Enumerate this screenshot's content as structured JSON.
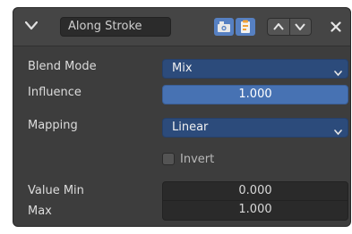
{
  "header": {
    "modifier_name": "Along Stroke",
    "collapse_icon": "chevron-down-icon",
    "render_icon": "camera-icon",
    "edit_icon": "clipboard-icon",
    "move_up_icon": "triangle-up-icon",
    "move_down_icon": "triangle-down-icon",
    "close_icon": "close-icon",
    "accent": "#5680c2"
  },
  "props": {
    "blend_mode_label": "Blend Mode",
    "blend_mode_value": "Mix",
    "influence_label": "Influence",
    "influence_value": "1.000",
    "mapping_label": "Mapping",
    "mapping_value": "Linear",
    "invert_label": "Invert",
    "invert_checked": false,
    "value_min_label": "Value Min",
    "value_min": "0.000",
    "max_label": "Max",
    "max_value": "1.000"
  },
  "colors": {
    "panel_bg": "#3d3d3d",
    "dropdown_bg": "#2c4b7b",
    "slider_bg": "#4772b3",
    "field_bg": "#2a2a2a"
  }
}
